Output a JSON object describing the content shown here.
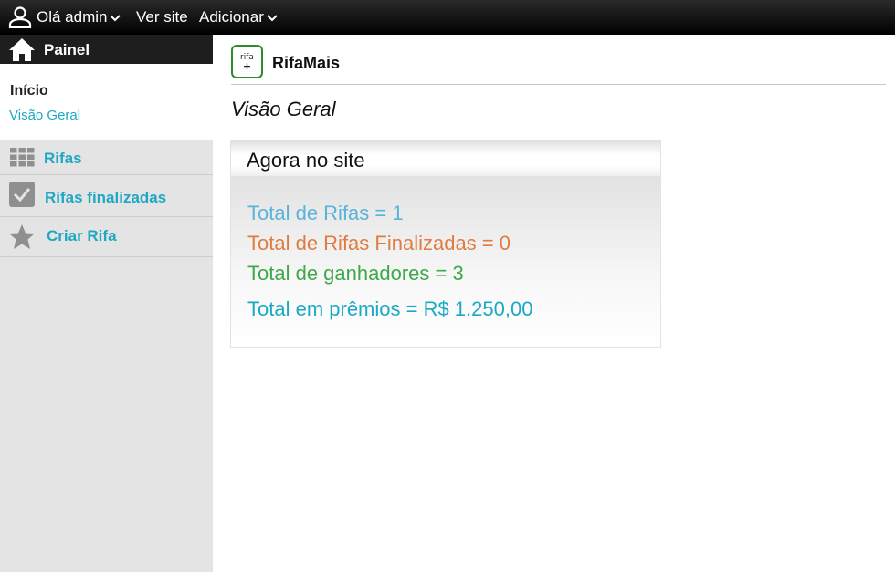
{
  "topbar": {
    "greeting": "Olá admin",
    "view_site": "Ver site",
    "add": "Adicionar"
  },
  "sidebar": {
    "painel_label": "Painel",
    "sub_heading": "Início",
    "sub_link": "Visão Geral",
    "items": [
      {
        "label": "Rifas",
        "icon": "grid-icon"
      },
      {
        "label": "Rifas finalizadas",
        "icon": "checkbox-icon"
      },
      {
        "label": "Criar Rifa",
        "icon": "star-icon"
      }
    ]
  },
  "main": {
    "logo_text_top": "rifa",
    "logo_text_bottom": "+",
    "brand": "RifaMais",
    "page_title": "Visão Geral",
    "card_title": "Agora no site",
    "stats": [
      {
        "text": "Total de Rifas = 1",
        "color": "#5ab4da"
      },
      {
        "text": "Total de Rifas Finalizadas = 0",
        "color": "#e07b41"
      },
      {
        "text": "Total de ganhadores = 3",
        "color": "#3fa84a"
      },
      {
        "text": "Total em prêmios = R$ 1.250,00",
        "color": "#1ba9c4"
      }
    ]
  },
  "colors": {
    "accent": "#1ea8c4",
    "topbar": "#000000",
    "sidebar": "#e4e4e4"
  }
}
